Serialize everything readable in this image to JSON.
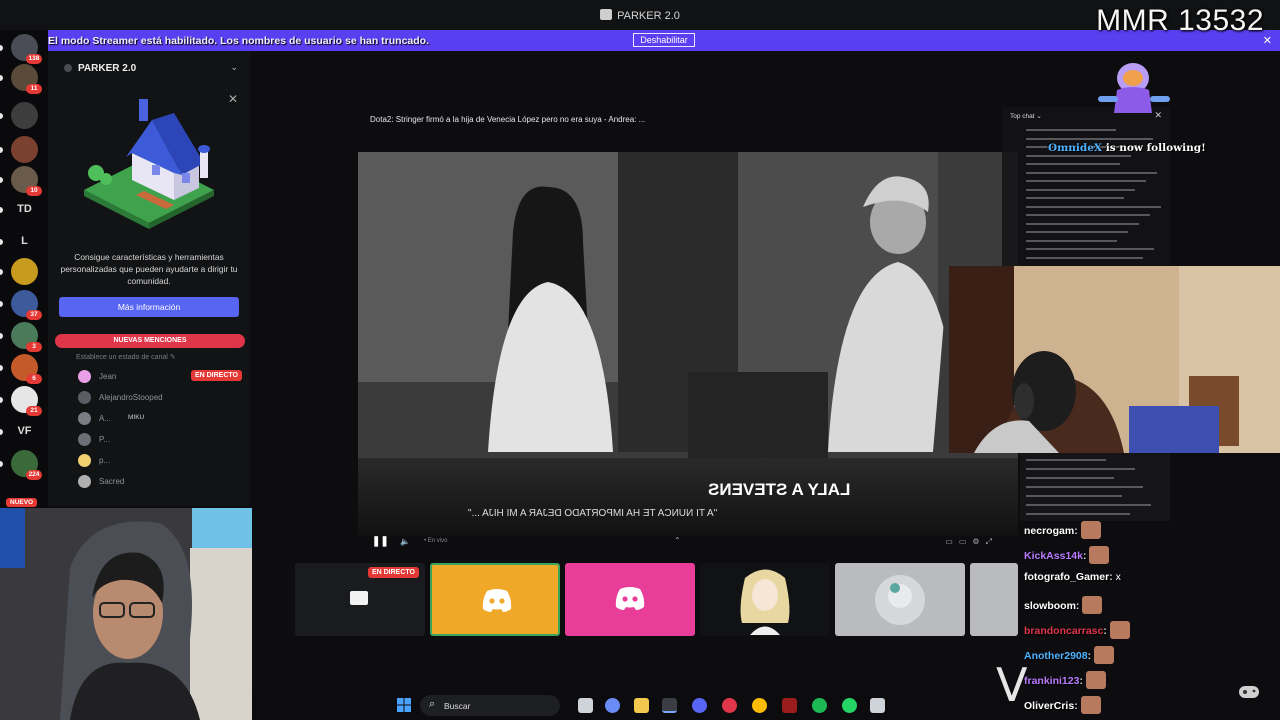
{
  "window": {
    "title": "PARKER 2.0"
  },
  "banner": {
    "message": "El modo Streamer está habilitado. Los nombres de usuario se han truncado.",
    "button": "Deshabilitar"
  },
  "overlay": {
    "mmr": "MMR 13532",
    "follow_user": "OmnideX",
    "follow_text": " is now following!"
  },
  "rail": {
    "servers": [
      {
        "label": "",
        "badge": "138"
      },
      {
        "label": "",
        "badge": "11"
      },
      {
        "label": "",
        "badge": ""
      },
      {
        "label": "",
        "badge": ""
      },
      {
        "label": "",
        "badge": "10"
      },
      {
        "label": "TD",
        "badge": ""
      },
      {
        "label": "L",
        "badge": ""
      },
      {
        "label": "",
        "badge": ""
      },
      {
        "label": "",
        "badge": "37"
      },
      {
        "label": "",
        "badge": "3"
      },
      {
        "label": "",
        "badge": "6"
      },
      {
        "label": "",
        "badge": "21"
      },
      {
        "label": "VF",
        "badge": ""
      },
      {
        "label": "",
        "badge": "224"
      }
    ],
    "new_label": "NUEVO"
  },
  "channel_panel": {
    "server_name": "PARKER 2.0",
    "promo_text": "Consigue características y herramientas personalizadas que pueden ayudarte a dirigir tu comunidad.",
    "promo_button": "Más información",
    "mentions_button": "NUEVAS MENCIONES",
    "status_hint": "Establece un estado de canal",
    "members": [
      {
        "name": "Jean",
        "live": "EN DIRECTO",
        "tag": ""
      },
      {
        "name": "AlejandroStooped",
        "live": "",
        "tag": ""
      },
      {
        "name": "A...",
        "live": "",
        "tag": "MIKU"
      },
      {
        "name": "P...",
        "live": "",
        "tag": ""
      },
      {
        "name": "p...",
        "live": "",
        "tag": ""
      },
      {
        "name": "Sacred",
        "live": "",
        "tag": ""
      }
    ]
  },
  "video": {
    "title": "Dota2:  Stringer firmó a la hija de Venecia López pero no era suya - Andrea: ...",
    "ticker_name": "LALY A STEVENS",
    "ticker_quote": "\"A TI NUNCA TE HA IMPORTADO DEJAR A MI HIJA ...\"",
    "time_label": "• En vivo"
  },
  "tiles": {
    "live_badge": "EN DIRECTO"
  },
  "chat_small": {
    "header": "Top chat"
  },
  "chat": [
    {
      "user": "necrogam",
      "color": "#ffffff",
      "text": "",
      "emote": true
    },
    {
      "user": "KickAss14k",
      "color": "#b97cff",
      "text": "",
      "emote": true
    },
    {
      "user": "fotografo_Gamer",
      "color": "#ffffff",
      "text": " x",
      "emote": false
    },
    {
      "user": "slowboom",
      "color": "#ffffff",
      "text": "",
      "emote": true
    },
    {
      "user": "brandoncarrasc",
      "color": "#e0364a",
      "text": "",
      "emote": true
    },
    {
      "user": "Another2908",
      "color": "#4fb3ff",
      "text": "",
      "emote": true
    },
    {
      "user": "frankini123",
      "color": "#b97cff",
      "text": "",
      "emote": true
    },
    {
      "user": "OliverCris",
      "color": "#ffffff",
      "text": "",
      "emote": true
    }
  ],
  "taskbar": {
    "search_label": "Buscar"
  },
  "colors": {
    "banner": "#5a3ff0",
    "discord_orange": "#f0a828",
    "discord_pink": "#e93d9a",
    "live_red": "#e53935",
    "blurple": "#5865f2"
  }
}
